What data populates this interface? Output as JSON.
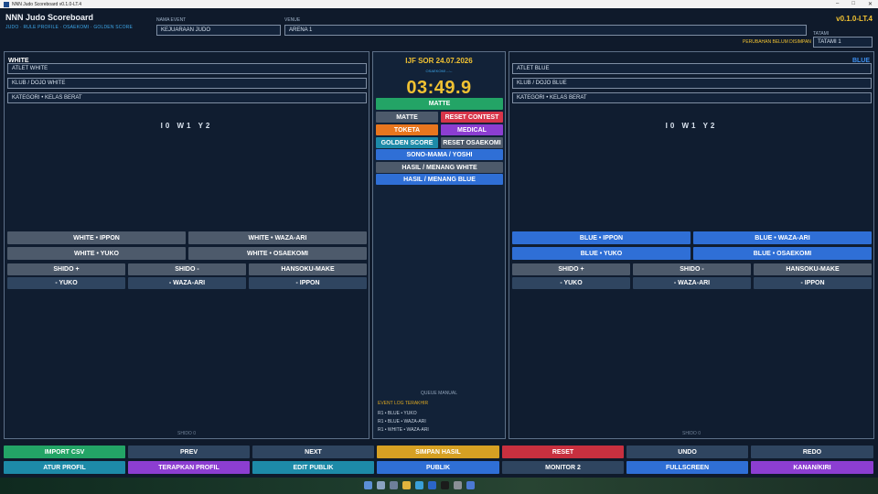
{
  "window": {
    "title": "NNN Judo Scoreboard v0.1.0-LT.4"
  },
  "header": {
    "app_title": "NNN Judo Scoreboard",
    "app_subtitle": "JUDO · RULE PROFILE · OSAEKOMI · GOLDEN SCORE",
    "event_label": "NAMA EVENT",
    "event_value": "KEJUARAAN JUDO",
    "venue_label": "VENUE",
    "venue_value": "ARENA 1",
    "tatami_label": "TATAMI",
    "tatami_value": "TATAMI 1",
    "version": "v0.1.0-LT.4",
    "unsaved_notice": "PERUBAHAN BELUM DISIMPAN"
  },
  "white": {
    "title": "WHITE",
    "athlete": "ATLET WHITE",
    "club": "KLUB / DOJO WHITE",
    "category": "KATEGORI • KELAS BERAT",
    "score": "I0 W1 Y2",
    "footer": "SHIDO 0",
    "buttons": {
      "ippon": "WHITE • IPPON",
      "wazaari": "WHITE • WAZA-ARI",
      "yuko": "WHITE • YUKO",
      "osaekomi": "WHITE • OSAEKOMI",
      "shido_plus": "SHIDO +",
      "shido_minus": "SHIDO -",
      "hansoku": "HANSOKU-MAKE",
      "minus_yuko": "- YUKO",
      "minus_wazaari": "- WAZA-ARI",
      "minus_ippon": "- IPPON"
    }
  },
  "blue": {
    "title": "BLUE",
    "athlete": "ATLET BLUE",
    "club": "KLUB / DOJO BLUE",
    "category": "KATEGORI • KELAS BERAT",
    "score": "I0 W1 Y2",
    "footer": "SHIDO 0",
    "buttons": {
      "ippon": "BLUE • IPPON",
      "wazaari": "BLUE • WAZA-ARI",
      "yuko": "BLUE • YUKO",
      "osaekomi": "BLUE • OSAEKOMI",
      "shido_plus": "SHIDO +",
      "shido_minus": "SHIDO -",
      "hansoku": "HANSOKU-MAKE",
      "minus_yuko": "- YUKO",
      "minus_wazaari": "- WAZA-ARI",
      "minus_ippon": "- IPPON"
    }
  },
  "center": {
    "event_name": "IJF SOR 24.07.2026",
    "osaekomi_label": "OSAEKOMI --:--",
    "timer": "03:49.9",
    "matte_main": "MATTE",
    "matte": "MATTE",
    "reset_contest": "RESET CONTEST",
    "toketa": "TOKETA",
    "medical": "MEDICAL",
    "golden_score": "GOLDEN SCORE",
    "reset_osaekomi": "RESET OSAEKOMI",
    "sono_mama": "SONO-MAMA / YOSHI",
    "hasil_white": "HASIL / MENANG WHITE",
    "hasil_blue": "HASIL / MENANG BLUE",
    "queue": "QUEUE MANUAL",
    "log_title": "EVENT LOG TERAKHIR",
    "log": [
      "R1 • BLUE • YUKO",
      "R1 • BLUE • WAZA-ARI",
      "R1 • WHITE • WAZA-ARI"
    ]
  },
  "bottom": {
    "import_csv": "IMPORT CSV",
    "prev": "PREV",
    "next": "NEXT",
    "simpan": "SIMPAN HASIL",
    "reset": "RESET",
    "undo": "UNDO",
    "redo": "REDO",
    "atur_profil": "ATUR PROFIL",
    "terapkan": "TERAPKAN PROFIL",
    "edit_publik": "EDIT PUBLIK",
    "publik": "PUBLIK",
    "monitor2": "MONITOR 2",
    "fullscreen": "FULLSCREEN",
    "kanan_kiri": "KANAN/KIRI"
  },
  "colors": {
    "accent": "#f1c232",
    "blue": "#2f6fd6",
    "green": "#23a466",
    "red": "#d7354a"
  }
}
